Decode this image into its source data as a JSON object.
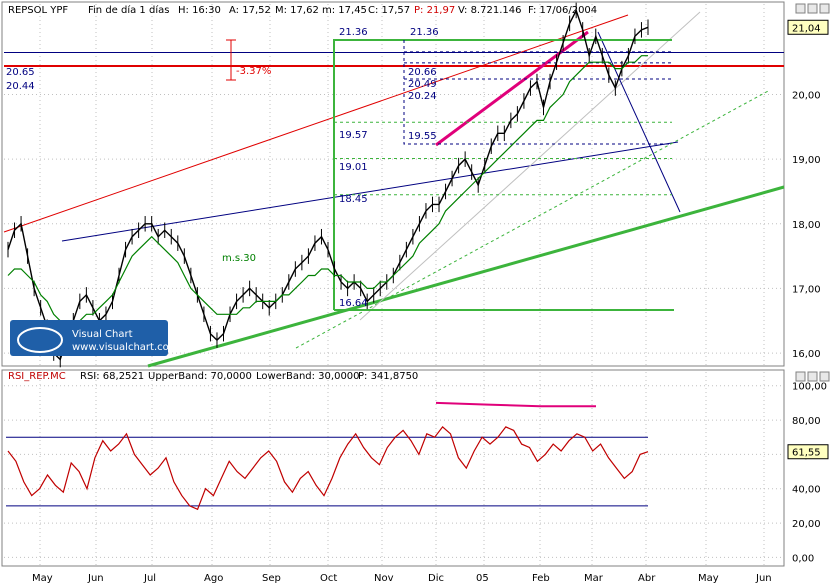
{
  "header": {
    "symbol": "REPSOL YPF",
    "period": "Fin de día 1 días",
    "H": "H: 16:30",
    "A": "A: 17,52",
    "M": "M: 17,62",
    "m": "m: 17,45",
    "C": "C: 17,57",
    "P": "P: 21,97",
    "V": "V: 8.721.146",
    "F": "F: 17/06/2004"
  },
  "logo": {
    "brand": "Visual Chart",
    "url": "www.visualchart.com"
  },
  "colors": {
    "bg": "#ffffff",
    "grid": "#c0c0c0",
    "price": "#000000",
    "ma": "#008000",
    "red": "#e00000",
    "blue": "#000080",
    "magenta": "#e0007a",
    "green": "#3cb43c",
    "rsi": "#c00000"
  },
  "chart_data": [
    {
      "type": "line",
      "title": "REPSOL YPF",
      "ylim": [
        15.8,
        21.4
      ],
      "yticks": [
        16.0,
        17.0,
        18.0,
        19.0,
        20.0
      ],
      "ytick_labels": [
        "16,00",
        "17,00",
        "18,00",
        "19,00",
        "20,00"
      ],
      "last_price_label": "21,04",
      "x_labels": [
        "May",
        "Jun",
        "Jul",
        "Ago",
        "Sep",
        "Oct",
        "Nov",
        "Dic",
        "05",
        "Feb",
        "Mar",
        "Abr",
        "May",
        "Jun"
      ],
      "ma_label": "m.s.30",
      "annotation_pct": "-3.37%",
      "levels": [
        {
          "label": "21.36",
          "value": 21.36
        },
        {
          "label": "21.36",
          "value": 21.36
        },
        {
          "label": "20.66",
          "value": 20.66
        },
        {
          "label": "20.65",
          "value": 20.65
        },
        {
          "label": "20.49",
          "value": 20.49
        },
        {
          "label": "20.44",
          "value": 20.44
        },
        {
          "label": "20.24",
          "value": 20.24
        },
        {
          "label": "19.57",
          "value": 19.57
        },
        {
          "label": "19.55",
          "value": 19.55
        },
        {
          "label": "19.01",
          "value": 19.01
        },
        {
          "label": "18.45",
          "value": 18.45
        },
        {
          "label": "16.64",
          "value": 16.64
        }
      ],
      "series": [
        {
          "values": [
            17.6,
            17.9,
            18.0,
            17.5,
            17.0,
            16.7,
            16.4,
            16.0,
            15.9,
            16.2,
            16.5,
            16.8,
            16.9,
            16.7,
            16.5,
            16.6,
            16.8,
            17.2,
            17.6,
            17.8,
            17.9,
            18.0,
            18.0,
            17.8,
            17.9,
            17.8,
            17.7,
            17.5,
            17.2,
            16.9,
            16.6,
            16.3,
            16.2,
            16.3,
            16.6,
            16.8,
            16.9,
            17.0,
            16.9,
            16.8,
            16.7,
            16.8,
            16.9,
            17.1,
            17.3,
            17.4,
            17.5,
            17.7,
            17.8,
            17.6,
            17.3,
            17.1,
            17.0,
            17.1,
            17.0,
            16.8,
            16.9,
            17.0,
            17.1,
            17.2,
            17.4,
            17.6,
            17.8,
            18.0,
            18.2,
            18.3,
            18.3,
            18.5,
            18.7,
            18.9,
            19.0,
            18.8,
            18.6,
            18.9,
            19.2,
            19.4,
            19.4,
            19.6,
            19.7,
            19.9,
            20.1,
            20.2,
            19.8,
            20.2,
            20.5,
            20.8,
            21.1,
            21.3,
            21.0,
            20.6,
            20.9,
            20.6,
            20.3,
            20.1,
            20.4,
            20.6,
            20.9,
            21.0,
            21.04
          ]
        },
        {
          "name": "m.s.30",
          "values": [
            17.2,
            17.3,
            17.3,
            17.2,
            17.1,
            16.9,
            16.8,
            16.6,
            16.5,
            16.5,
            16.5,
            16.5,
            16.6,
            16.6,
            16.7,
            16.8,
            16.9,
            17.1,
            17.3,
            17.5,
            17.6,
            17.7,
            17.8,
            17.7,
            17.6,
            17.5,
            17.4,
            17.2,
            17.0,
            16.9,
            16.8,
            16.7,
            16.6,
            16.6,
            16.6,
            16.6,
            16.7,
            16.7,
            16.8,
            16.8,
            16.8,
            16.8,
            16.9,
            16.9,
            17.0,
            17.1,
            17.2,
            17.2,
            17.3,
            17.3,
            17.2,
            17.2,
            17.1,
            17.1,
            17.1,
            17.0,
            17.0,
            17.1,
            17.1,
            17.2,
            17.3,
            17.4,
            17.5,
            17.7,
            17.8,
            17.9,
            18.0,
            18.2,
            18.3,
            18.4,
            18.5,
            18.6,
            18.7,
            18.8,
            18.9,
            19.0,
            19.1,
            19.2,
            19.3,
            19.4,
            19.5,
            19.6,
            19.6,
            19.8,
            19.9,
            20.0,
            20.2,
            20.3,
            20.4,
            20.5,
            20.5,
            20.5,
            20.5,
            20.4,
            20.4,
            20.5,
            20.5,
            20.6,
            20.6
          ]
        }
      ]
    },
    {
      "type": "line",
      "title": "RSI_REP.MC",
      "readout": [
        "RSI: 68,2521",
        "UpperBand: 70,0000",
        "LowerBand: 30,0000",
        "P: 341,8750"
      ],
      "ylim": [
        -5,
        108
      ],
      "yticks": [
        0,
        20,
        40,
        60,
        80,
        100
      ],
      "ytick_labels": [
        "0,00",
        "20,00",
        "40,00",
        "60,00",
        "80,00",
        "100,00"
      ],
      "last_label": "61,55",
      "upper_band": 70,
      "lower_band": 30,
      "series": [
        {
          "name": "RSI",
          "values": [
            62,
            56,
            44,
            36,
            40,
            48,
            42,
            38,
            55,
            50,
            40,
            58,
            68,
            62,
            66,
            72,
            60,
            54,
            48,
            52,
            58,
            44,
            36,
            30,
            28,
            40,
            36,
            46,
            56,
            50,
            46,
            52,
            58,
            62,
            56,
            44,
            38,
            46,
            50,
            42,
            36,
            46,
            58,
            66,
            72,
            64,
            58,
            54,
            64,
            70,
            74,
            68,
            60,
            72,
            70,
            76,
            72,
            58,
            52,
            62,
            70,
            66,
            70,
            76,
            74,
            66,
            64,
            56,
            60,
            66,
            62,
            68,
            72,
            70,
            62,
            66,
            58,
            52,
            46,
            50,
            60,
            61.55
          ]
        },
        {
          "name": "divergence",
          "values": [
            90,
            89,
            88,
            88
          ]
        }
      ]
    }
  ]
}
